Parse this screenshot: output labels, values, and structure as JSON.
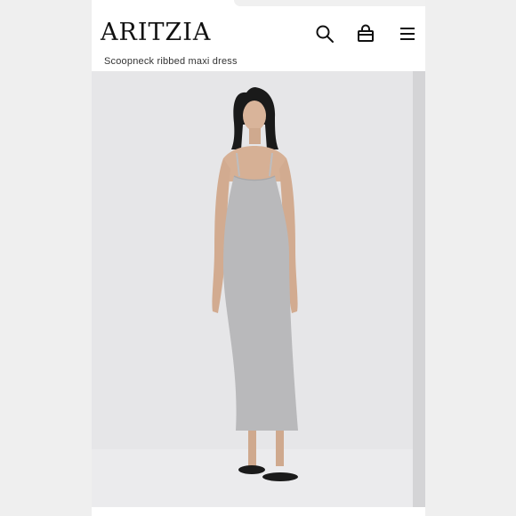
{
  "header": {
    "brand": "ARITZIA",
    "product_name": "Scoopneck ribbed maxi dress"
  },
  "icons": {
    "search": "search-icon",
    "bag": "shopping-bag-icon",
    "menu": "hamburger-menu-icon"
  },
  "colors": {
    "brand_text": "#111111",
    "dress": "#b9b9bb",
    "background": "#e6e6e8"
  }
}
